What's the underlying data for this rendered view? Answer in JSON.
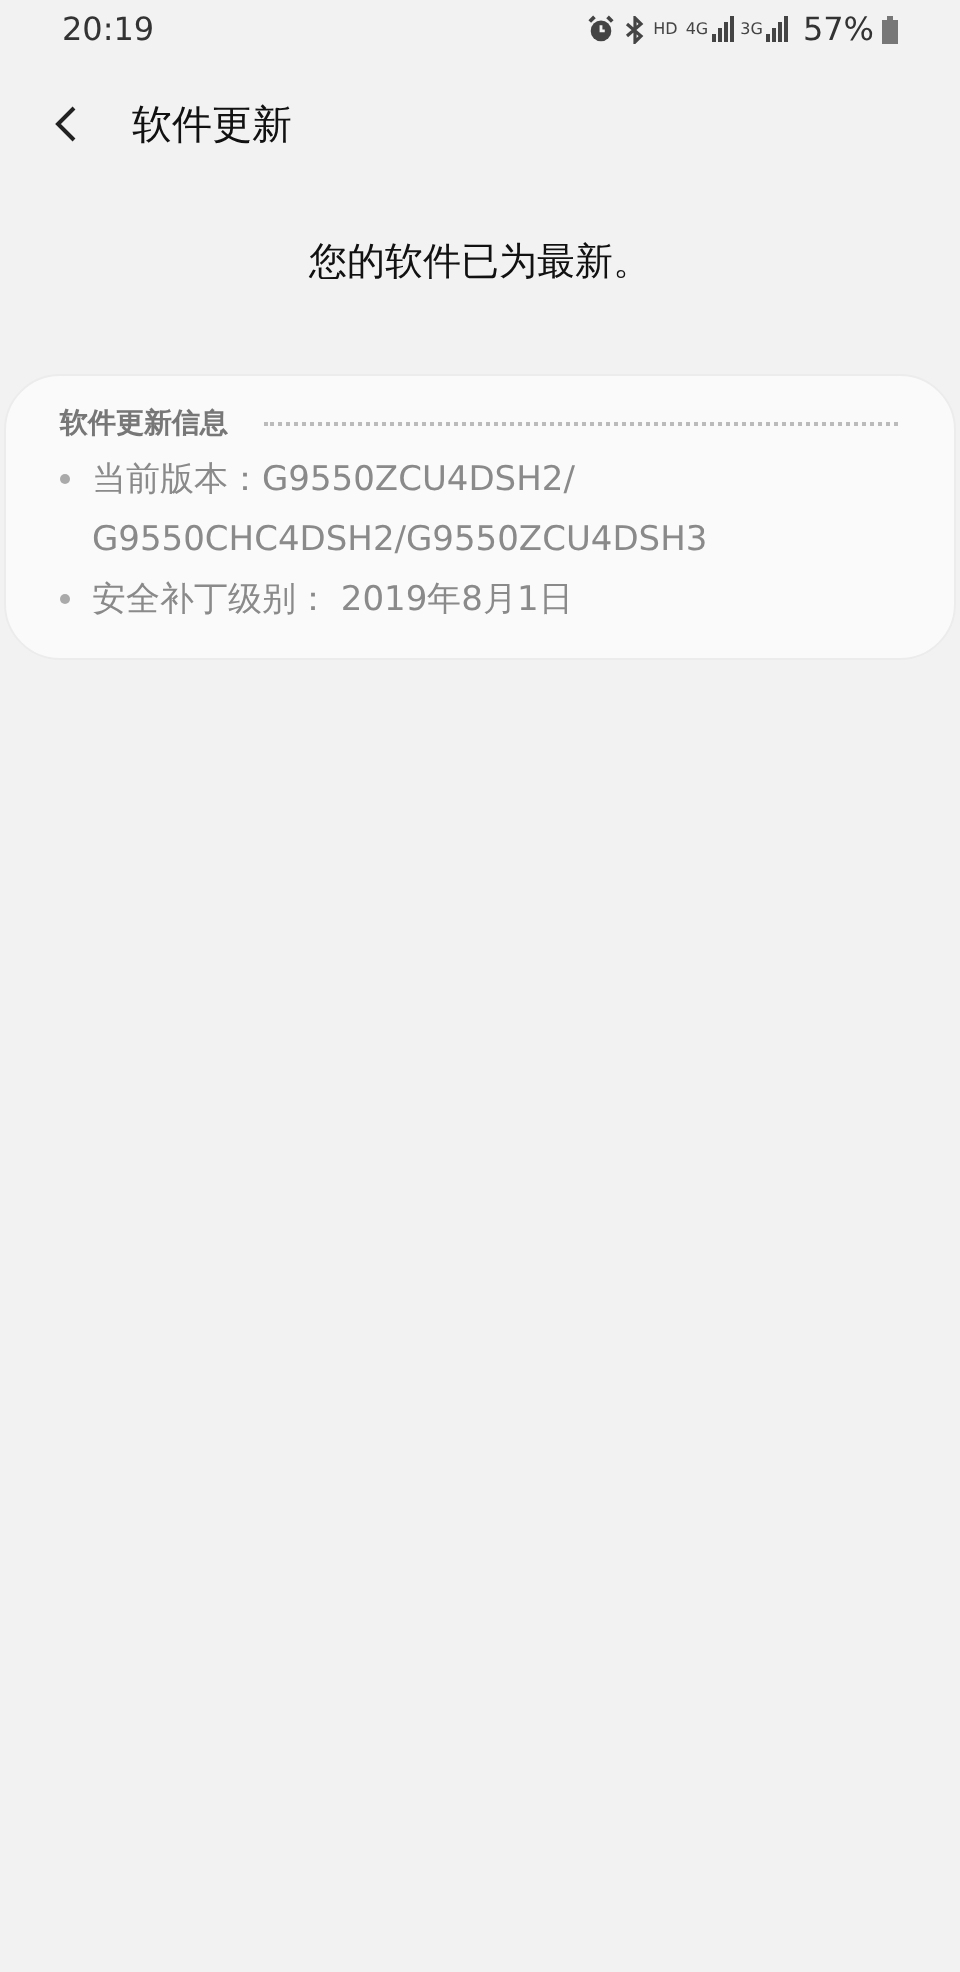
{
  "status_bar": {
    "time": "20:19",
    "hd_label": "HD",
    "network_labels": [
      "4G",
      "3G"
    ],
    "battery": "57%"
  },
  "header": {
    "title": "软件更新"
  },
  "message": "您的软件已为最新。",
  "info_card": {
    "title": "软件更新信息",
    "items": [
      "当前版本：G9550ZCU4DSH2/ G9550CHC4DSH2/G9550ZCU4DSH3",
      "安全补丁级别： 2019年8月1日"
    ]
  }
}
